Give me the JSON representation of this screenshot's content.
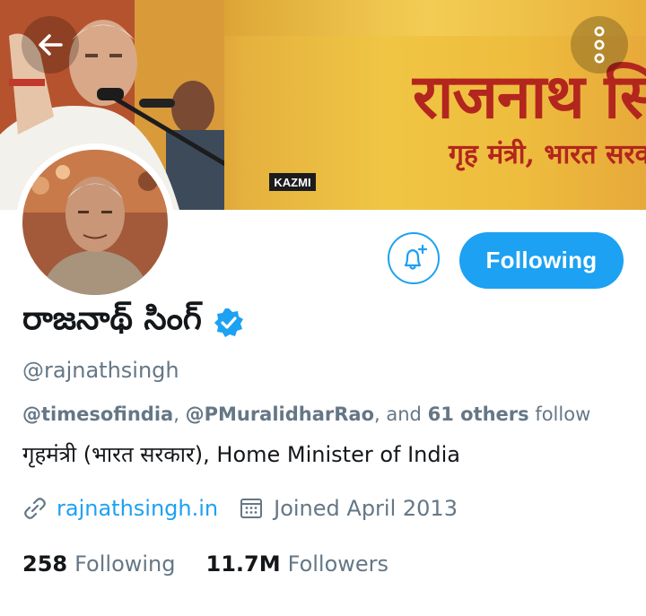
{
  "banner": {
    "title": "राजनाथ सिंह",
    "subtitle": "गृह मंत्री, भारत सरकार",
    "mic_label": "KAZMI"
  },
  "header": {
    "back_icon": "arrow-left-icon",
    "more_icon": "more-vertical-icon"
  },
  "actions": {
    "notifications_icon": "bell-plus-icon",
    "following_label": "Following"
  },
  "profile": {
    "display_name": "రాజనాథ్ సింగ్",
    "verified": true,
    "handle": "@rajnathsingh",
    "followed_by": {
      "user1": "@timesofindia",
      "sep1": ", ",
      "user2": "@PMuralidharRao",
      "sep2": ", and ",
      "others": "61 others",
      "suffix": " follow"
    },
    "bio": "गृहमंत्री (भारत सरकार), Home Minister of India",
    "website": "rajnathsingh.in",
    "joined": "Joined April 2013",
    "stats": {
      "following_count": "258",
      "following_label": "Following",
      "followers_count": "11.7M",
      "followers_label": "Followers"
    }
  },
  "colors": {
    "accent": "#1da1f2",
    "muted": "#657786",
    "text": "#14171a",
    "banner_text": "#b3261e"
  }
}
